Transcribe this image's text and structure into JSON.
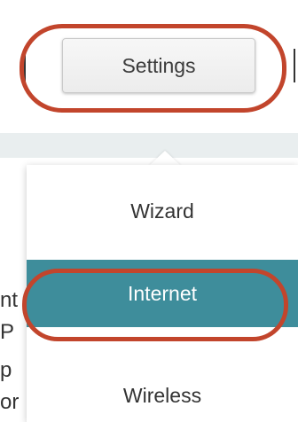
{
  "toolbar": {
    "settings_label": "Settings"
  },
  "menu": {
    "items": [
      {
        "label": "Wizard"
      },
      {
        "label": "Internet",
        "selected": true
      },
      {
        "label": "Wireless"
      }
    ]
  },
  "background_text": [
    "nt",
    "P",
    "p",
    "or"
  ],
  "colors": {
    "highlight_ring": "#c2452c",
    "selected_item": "#3e8d9b"
  }
}
